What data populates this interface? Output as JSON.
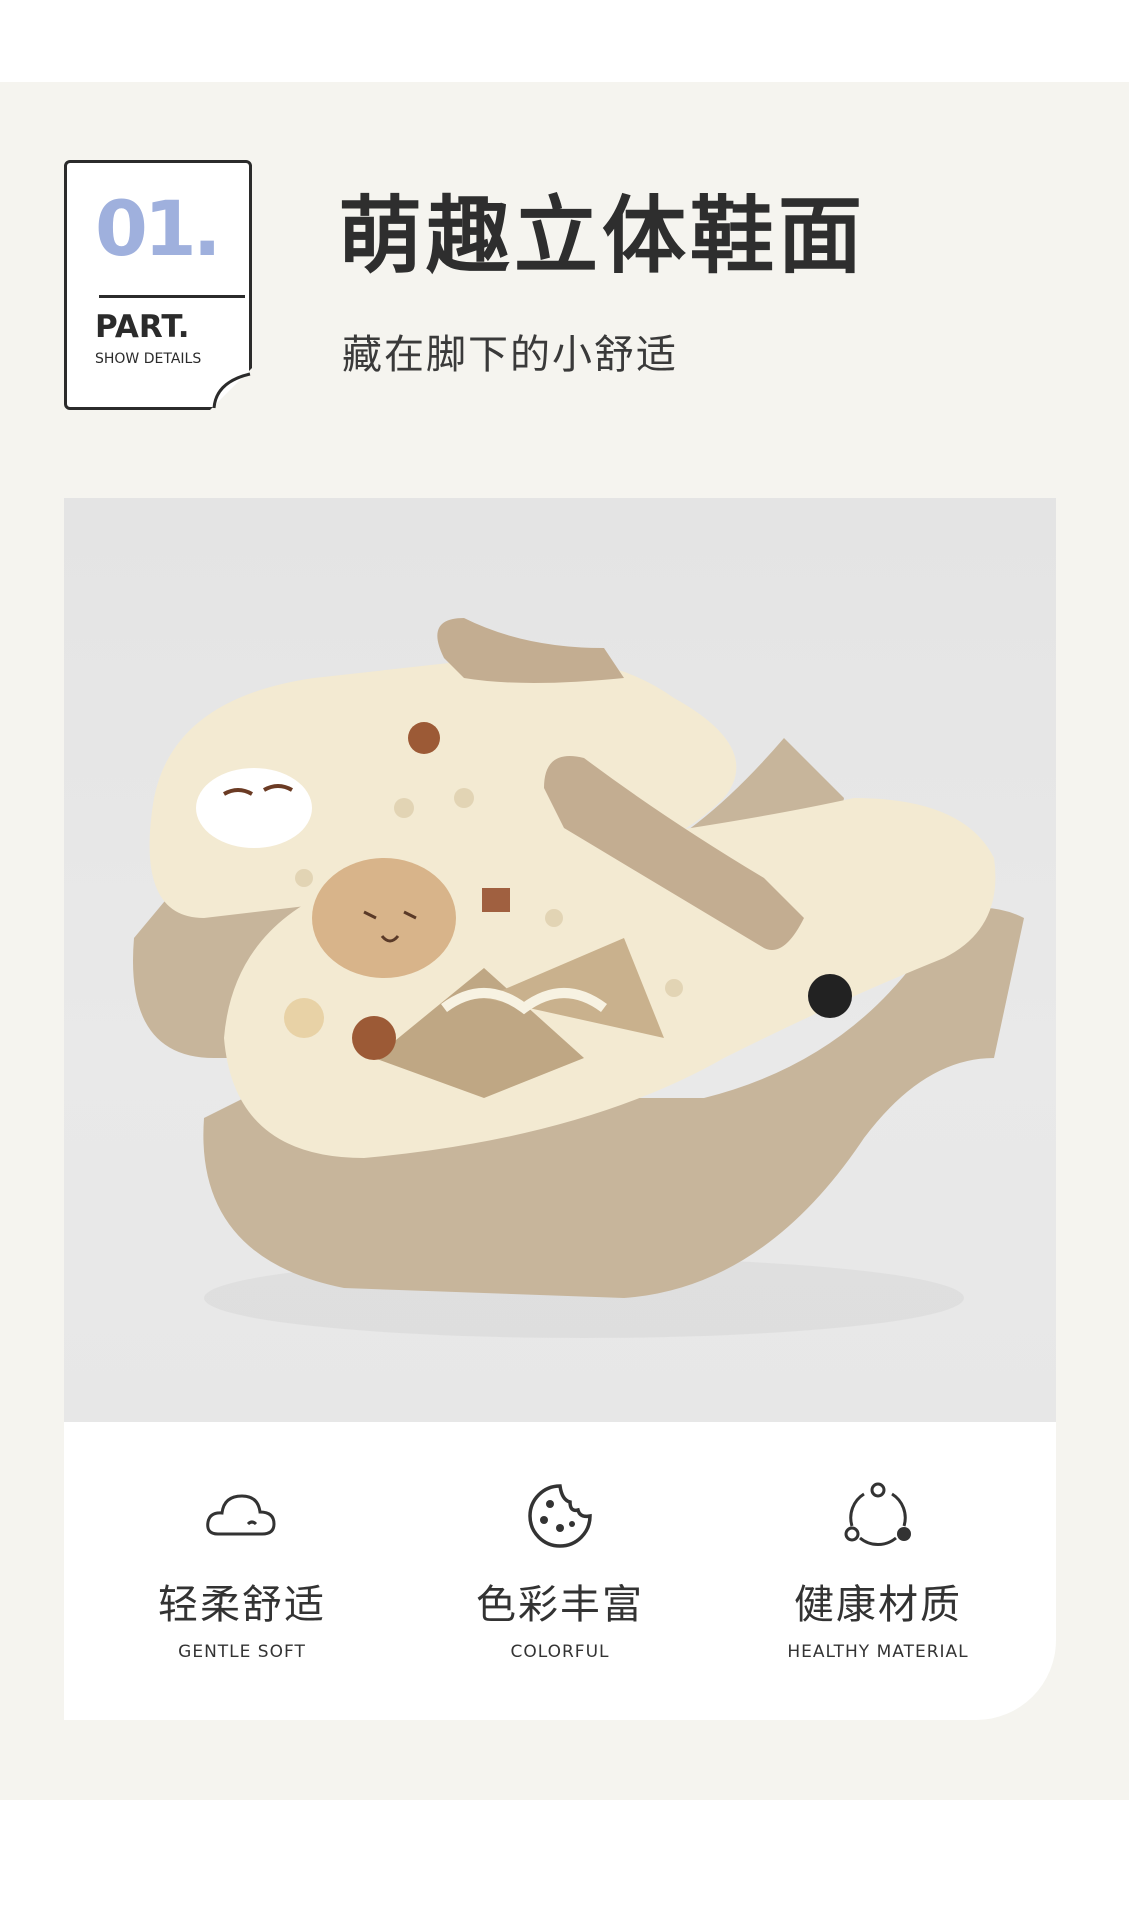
{
  "part_card": {
    "number": "01.",
    "label": "PART.",
    "sublabel": "SHOW DETAILS"
  },
  "heading": {
    "title": "萌趣立体鞋面",
    "subtitle": "藏在脚下的小舒适"
  },
  "features": [
    {
      "icon": "cloud-icon",
      "title": "轻柔舒适",
      "subtitle": "GENTLE SOFT"
    },
    {
      "icon": "cookie-icon",
      "title": "色彩丰富",
      "subtitle": "COLORFUL"
    },
    {
      "icon": "cycle-icon",
      "title": "健康材质",
      "subtitle": "HEALTHY MATERIAL"
    }
  ],
  "colors": {
    "accent_number": "#9fb0dd",
    "text_dark": "#2e2e2e",
    "panel_bg": "#f5f4ef",
    "shoe_cream": "#f3ead2",
    "shoe_sole": "#c7b59b"
  }
}
